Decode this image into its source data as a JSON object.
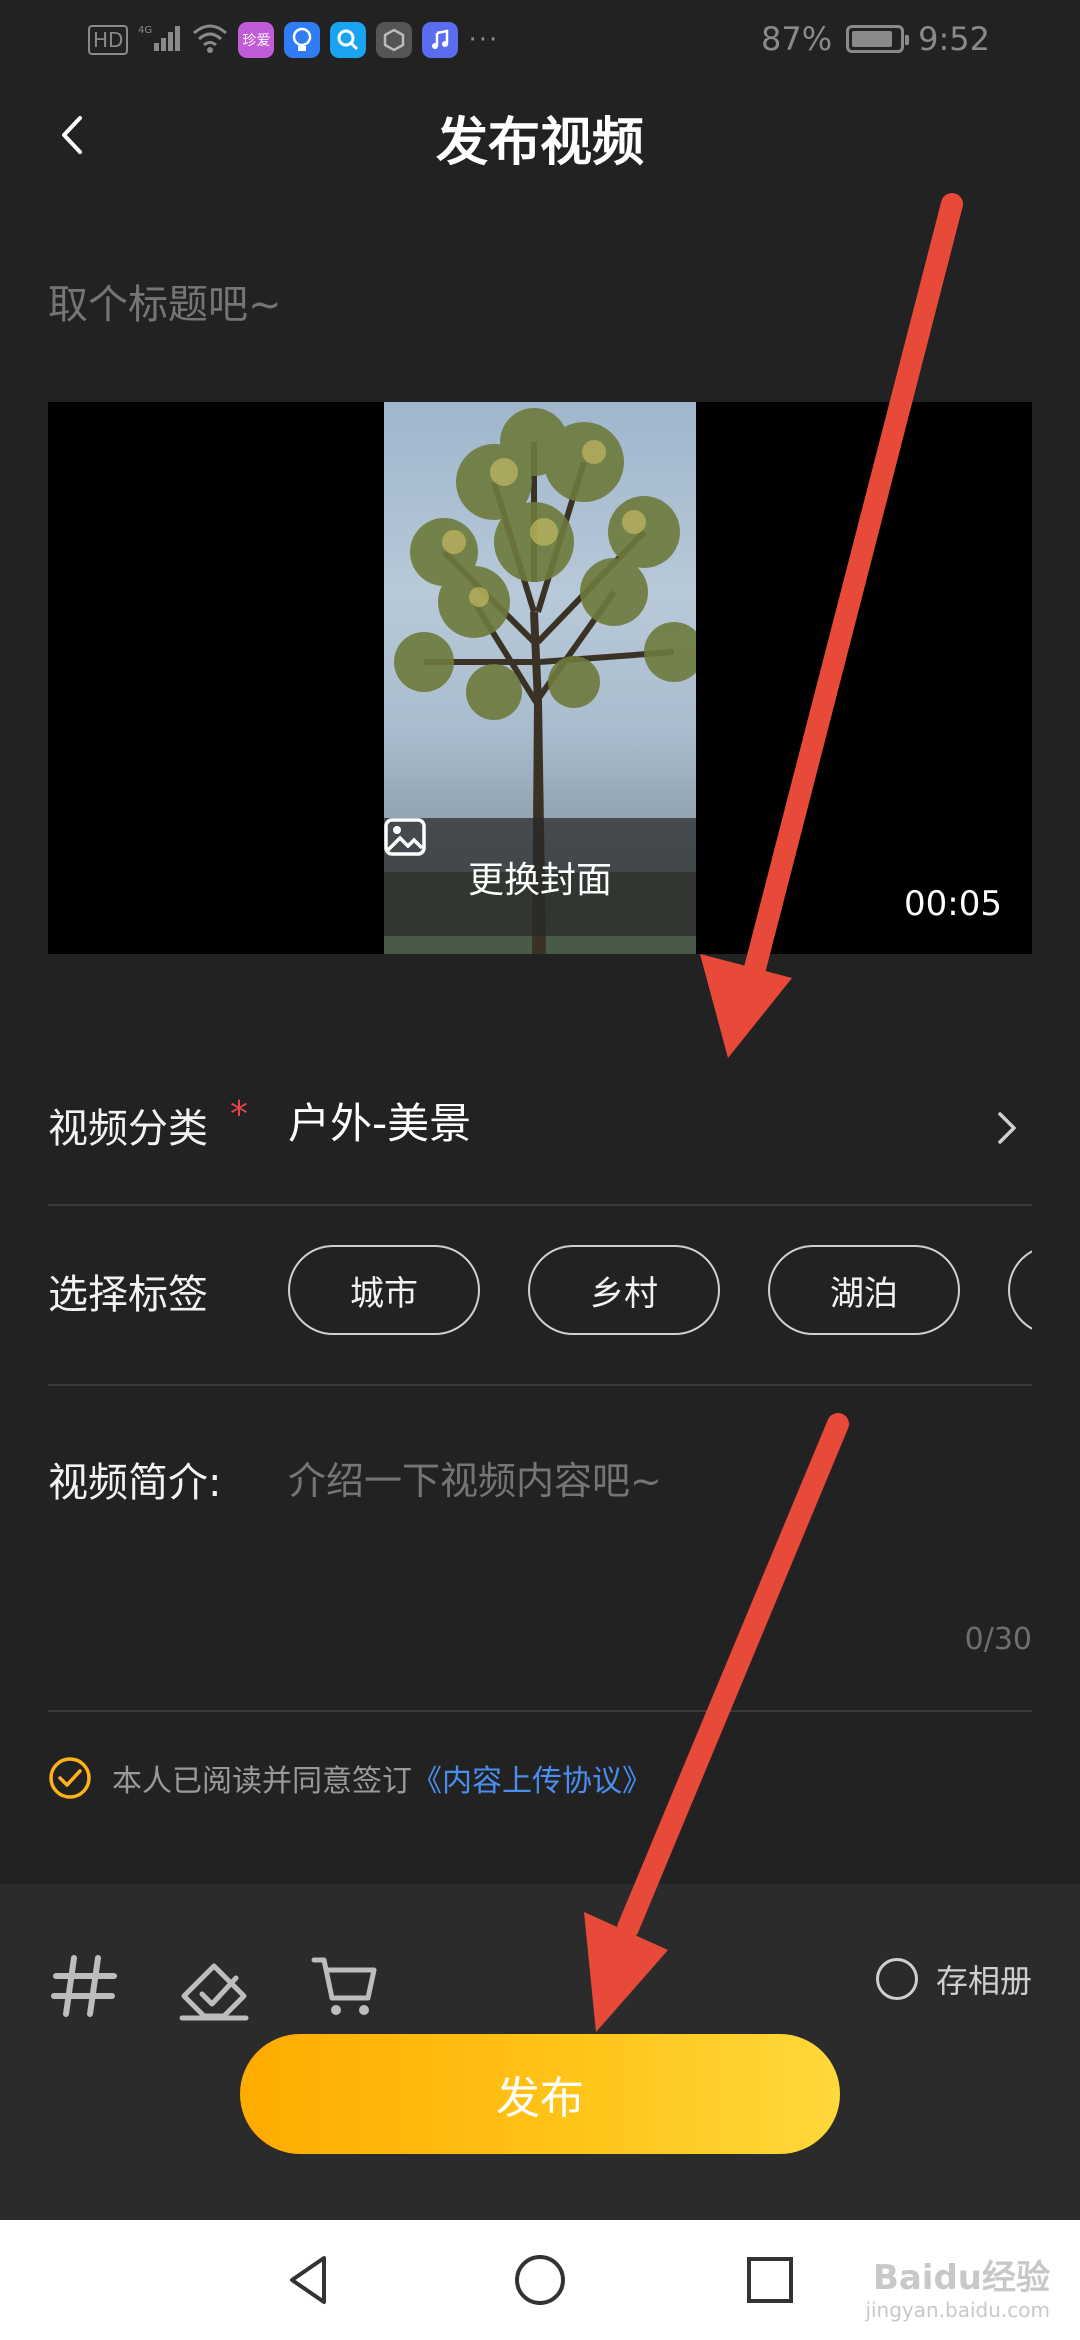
{
  "status_bar": {
    "hd_label": "HD",
    "app_badge": "珍爱",
    "dots": "···",
    "battery_percent": "87%",
    "time": "9:52"
  },
  "header": {
    "title": "发布视频"
  },
  "title_input": {
    "placeholder": "取个标题吧~"
  },
  "video": {
    "change_cover_label": "更换封面",
    "duration": "00:05"
  },
  "category": {
    "label": "视频分类",
    "required_mark": "*",
    "value": "户外-美景"
  },
  "tags": {
    "label": "选择标签",
    "items": [
      "城市",
      "乡村",
      "湖泊"
    ]
  },
  "description": {
    "label": "视频简介:",
    "placeholder": "介绍一下视频内容吧~",
    "char_count": "0/30"
  },
  "agreement": {
    "text": "本人已阅读并同意签订",
    "link": "《内容上传协议》",
    "checked": true
  },
  "bottom_toolbar": {
    "tools": [
      "hashtag-icon",
      "checkmark-draft-icon",
      "cart-icon"
    ],
    "save_album_label": "存相册",
    "publish_label": "发布"
  },
  "watermark": {
    "brand": "Baidu经验",
    "url": "jingyan.baidu.com"
  },
  "colors": {
    "background": "#222222",
    "accent_yellow": "#ffc61c",
    "required_red": "#e8414f",
    "link_blue": "#4a8ef0",
    "annotation_arrow": "#e84a3a"
  }
}
